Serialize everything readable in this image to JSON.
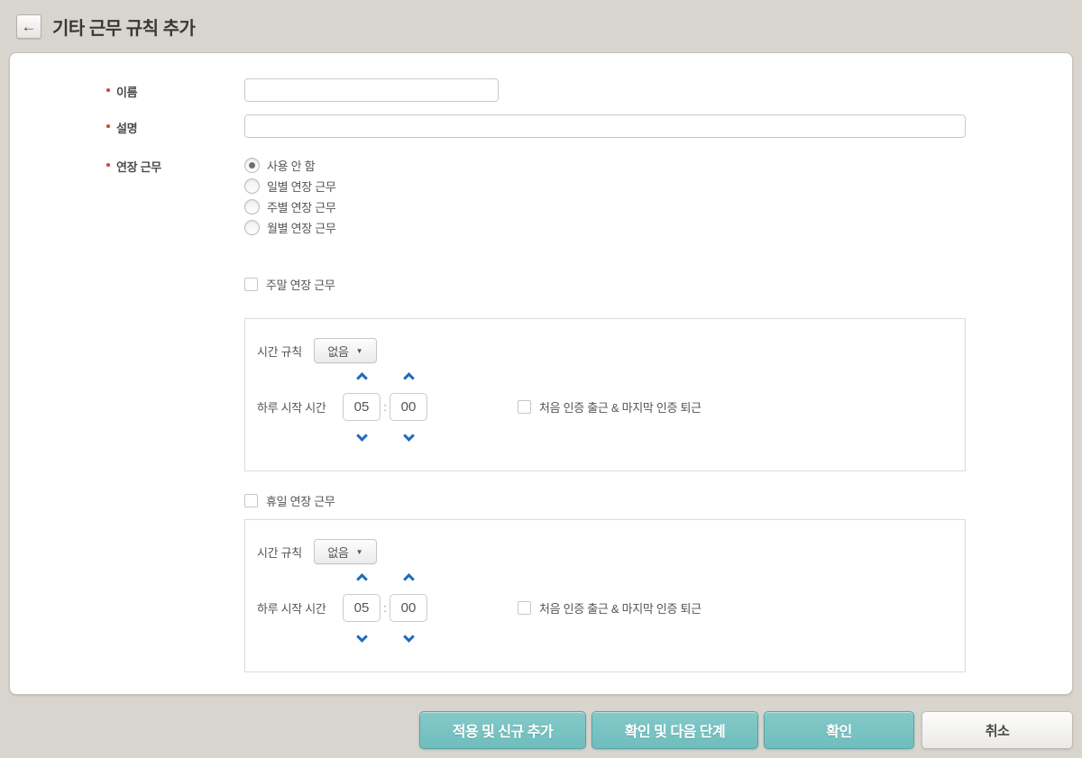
{
  "colors": {
    "accent_teal": "#74c2c2",
    "spinner_arrow_blue": "#1b6cbe",
    "required_red": "#cc4433",
    "page_background": "#d8d4ce"
  },
  "icons": {
    "back": "←",
    "caret_down": "▼"
  },
  "header": {
    "title": "기타 근무 규칙 추가"
  },
  "form": {
    "name": {
      "label": "이름",
      "required": true,
      "value": ""
    },
    "description": {
      "label": "설명",
      "required": true,
      "value": ""
    },
    "overtime": {
      "label": "연장 근무",
      "required": true,
      "options": [
        {
          "label": "사용 안 함",
          "selected": true
        },
        {
          "label": "일별 연장 근무",
          "selected": false
        },
        {
          "label": "주별 연장 근무",
          "selected": false
        },
        {
          "label": "월별 연장 근무",
          "selected": false
        }
      ]
    },
    "weekend": {
      "checkbox_label": "주말 연장 근무",
      "checked": false,
      "panel": {
        "time_rule_label": "시간 규칙",
        "time_rule_value": "없음",
        "day_start_label": "하루 시작 시간",
        "hour": "05",
        "minute": "00",
        "time_separator": ":",
        "auth_label": "처음 인증 출근 & 마지막 인증 퇴근",
        "auth_checked": false
      }
    },
    "holiday": {
      "checkbox_label": "휴일 연장 근무",
      "checked": false,
      "panel": {
        "time_rule_label": "시간 규칙",
        "time_rule_value": "없음",
        "day_start_label": "하루 시작 시간",
        "hour": "05",
        "minute": "00",
        "time_separator": ":",
        "auth_label": "처음 인증 출근 & 마지막 인증 퇴근",
        "auth_checked": false
      }
    }
  },
  "footer": {
    "buttons": [
      {
        "label": "적용 및 신규 추가"
      },
      {
        "label": "확인 및 다음 단계"
      },
      {
        "label": "확인"
      },
      {
        "label": "취소"
      }
    ]
  }
}
